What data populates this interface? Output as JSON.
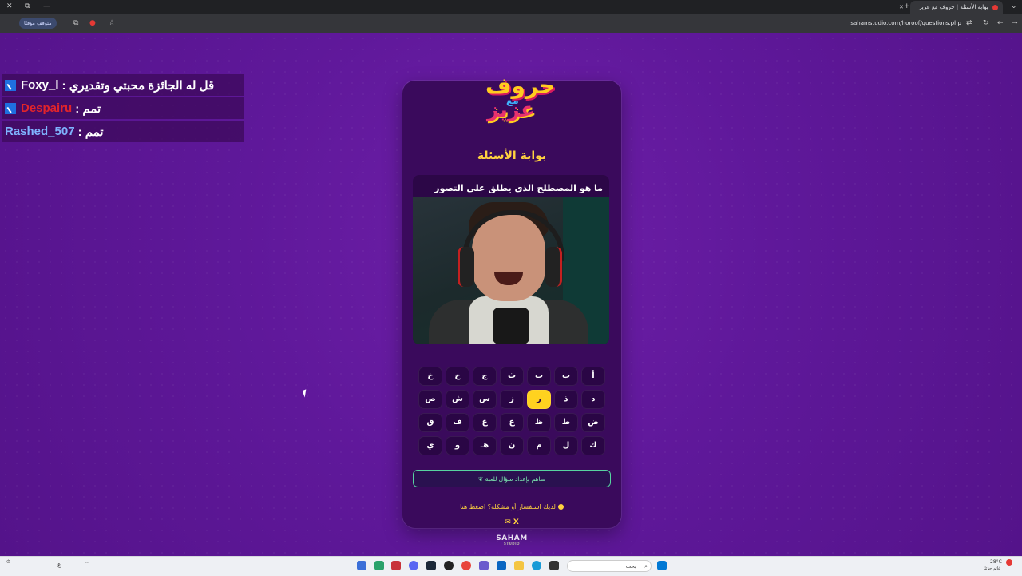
{
  "browser": {
    "tab_title": "بوابة الأسئلة | حروف مع عزيز",
    "url": "sahamstudio.com/horoof/questions.php",
    "pause_badge": "متوقف مؤقتًا"
  },
  "chat": [
    {
      "name": "Foxy_l",
      "name_color": "#ffffff",
      "message": "قل له الجائزة محبتي وتقديري :"
    },
    {
      "name": "Despairu",
      "name_color": "#e1242b",
      "message": "تمم :"
    },
    {
      "name": "Rashed_507",
      "name_color": "#7fb4ff",
      "message": "تمم :"
    }
  ],
  "card": {
    "logo_top": "حروف",
    "logo_mid": "مع",
    "logo_bottom": "عزيز",
    "title": "بوابة الأسئلة",
    "question": "ما هو المصطلح الذي يطلق على التصور",
    "keys_row1": [
      "أ",
      "ب",
      "ت",
      "ث",
      "ج",
      "ح",
      "خ"
    ],
    "keys_row2": [
      "د",
      "ذ",
      "ر",
      "ز",
      "س",
      "ش",
      "ص"
    ],
    "keys_row3": [
      "ض",
      "ط",
      "ظ",
      "ع",
      "غ",
      "ف",
      "ق"
    ],
    "keys_row4": [
      "ك",
      "ل",
      "م",
      "ن",
      "هـ",
      "و",
      "ي"
    ],
    "active_key": "ر",
    "contribute_button": "ساهم بإعداد سؤال للعبة",
    "help_text": "لديك استفسار أو مشكلة؟ اضغط هنا",
    "social": "✉ X",
    "brand": "SAHAM",
    "brand_sub": "STUDIO"
  },
  "taskbar": {
    "search_placeholder": "بحث",
    "weather": "28°C",
    "weather_sub": "غائم جزئيًا",
    "lang": "ع"
  },
  "colors": {
    "page_bg": "#5a1690",
    "card_bg": "#3a0a5c",
    "accent_yellow": "#ffd21f",
    "accent_green": "#57d4a0"
  }
}
